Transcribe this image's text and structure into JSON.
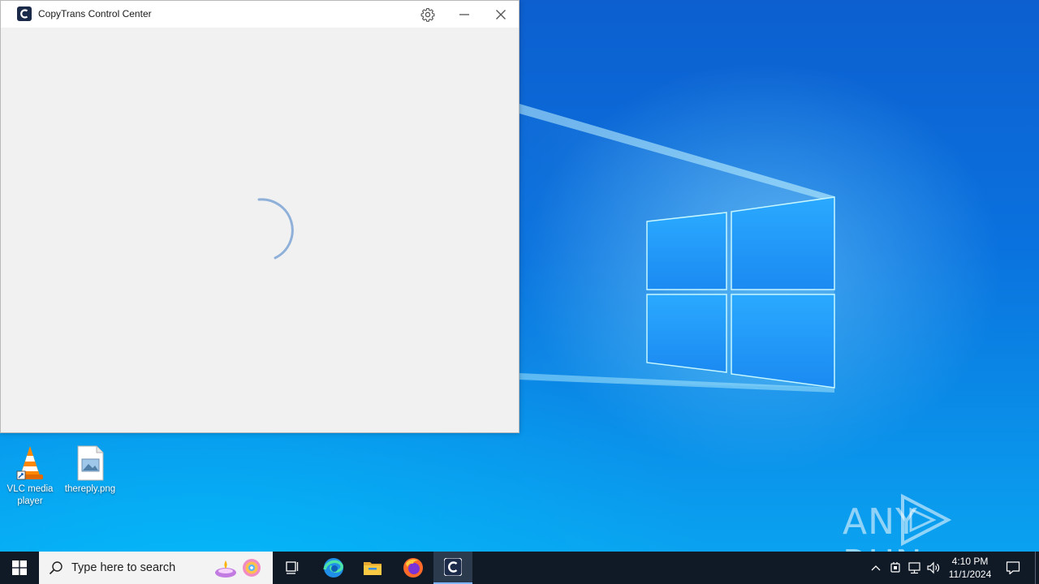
{
  "window": {
    "title": "CopyTrans Control Center",
    "settings_icon": "gear-icon",
    "minimize_icon": "minimize-icon",
    "close_icon": "close-icon",
    "state": "loading"
  },
  "desktop": {
    "icons": [
      {
        "label": "VLC media player",
        "icon": "vlc-cone-icon"
      },
      {
        "label": "thereply.png",
        "icon": "image-file-icon"
      }
    ],
    "watermark": "ANY RUN"
  },
  "taskbar": {
    "start_icon": "windows-start-icon",
    "search_placeholder": "Type here to search",
    "pinned": [
      "task-view-icon",
      "edge-icon",
      "file-explorer-icon",
      "firefox-icon",
      "copytrans-icon"
    ],
    "tray_icons": [
      "chevron-up-icon",
      "device-icon",
      "network-icon",
      "volume-icon"
    ],
    "time": "4:10 PM",
    "date": "11/1/2024",
    "notification_icon": "notification-icon"
  },
  "colors": {
    "accent": "#0078d7",
    "taskbar": "#101a27",
    "window_bg": "#f1f1f1"
  }
}
